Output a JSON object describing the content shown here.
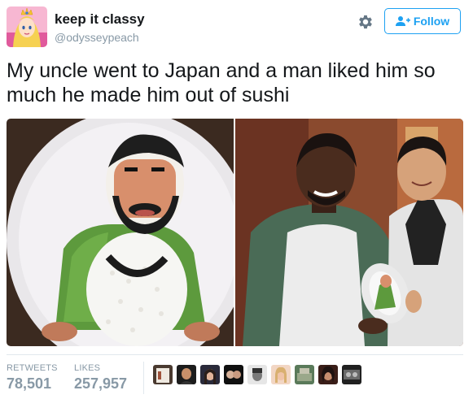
{
  "user": {
    "display_name": "keep it classy",
    "handle": "@odysseypeach",
    "avatar_icon": "princess-peach-avatar"
  },
  "actions": {
    "settings_icon": "gear-icon",
    "follow_label": "Follow",
    "follow_icon": "add-user-icon",
    "accent_color": "#1da1f2"
  },
  "tweet": {
    "text": "My uncle went to Japan and a man liked him so much he made him out of sushi"
  },
  "media": {
    "left_image": "sushi-figure-photo",
    "right_image": "two-men-holding-plate-photo"
  },
  "stats": {
    "retweets_label": "RETWEETS",
    "retweets_value": "78,501",
    "likes_label": "LIKES",
    "likes_value": "257,957"
  },
  "likers": [
    {
      "icon": "liker-avatar-1"
    },
    {
      "icon": "liker-avatar-2"
    },
    {
      "icon": "liker-avatar-3"
    },
    {
      "icon": "liker-avatar-4"
    },
    {
      "icon": "liker-avatar-5"
    },
    {
      "icon": "liker-avatar-6"
    },
    {
      "icon": "liker-avatar-7"
    },
    {
      "icon": "liker-avatar-8"
    },
    {
      "icon": "liker-avatar-9"
    }
  ]
}
